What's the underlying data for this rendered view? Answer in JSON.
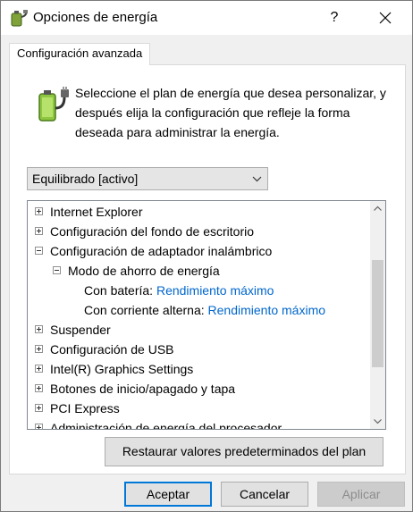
{
  "window": {
    "title": "Opciones de energía",
    "help_label": "?"
  },
  "tab": {
    "label": "Configuración avanzada"
  },
  "intro": {
    "text": "Seleccione el plan de energía que desea personalizar, y después elija la configuración que refleje la forma deseada para administrar la energía."
  },
  "plan_select": {
    "value": "Equilibrado [activo]"
  },
  "tree": {
    "items": [
      {
        "label": "Internet Explorer",
        "state": "collapsed"
      },
      {
        "label": "Configuración del fondo de escritorio",
        "state": "collapsed"
      },
      {
        "label": "Configuración de adaptador inalámbrico",
        "state": "expanded"
      },
      {
        "label": "Modo de ahorro de energía",
        "state": "expanded"
      },
      {
        "label": "Con batería:",
        "value": "Rendimiento máximo"
      },
      {
        "label": "Con corriente alterna:",
        "value": "Rendimiento máximo"
      },
      {
        "label": "Suspender",
        "state": "collapsed"
      },
      {
        "label": "Configuración de USB",
        "state": "collapsed"
      },
      {
        "label": "Intel(R) Graphics Settings",
        "state": "collapsed"
      },
      {
        "label": "Botones de inicio/apagado y tapa",
        "state": "collapsed"
      },
      {
        "label": "PCI Express",
        "state": "collapsed"
      },
      {
        "label": "Administración de energía del procesador",
        "state": "collapsed"
      }
    ]
  },
  "buttons": {
    "restore": "Restaurar valores predeterminados del plan",
    "ok": "Aceptar",
    "cancel": "Cancelar",
    "apply": "Aplicar"
  },
  "colors": {
    "link": "#0066cc",
    "focus_border": "#0078d7"
  },
  "icons": [
    "power-options-icon",
    "battery-plug-icon",
    "chevron-down-icon",
    "close-icon",
    "scroll-up-icon",
    "scroll-down-icon"
  ]
}
